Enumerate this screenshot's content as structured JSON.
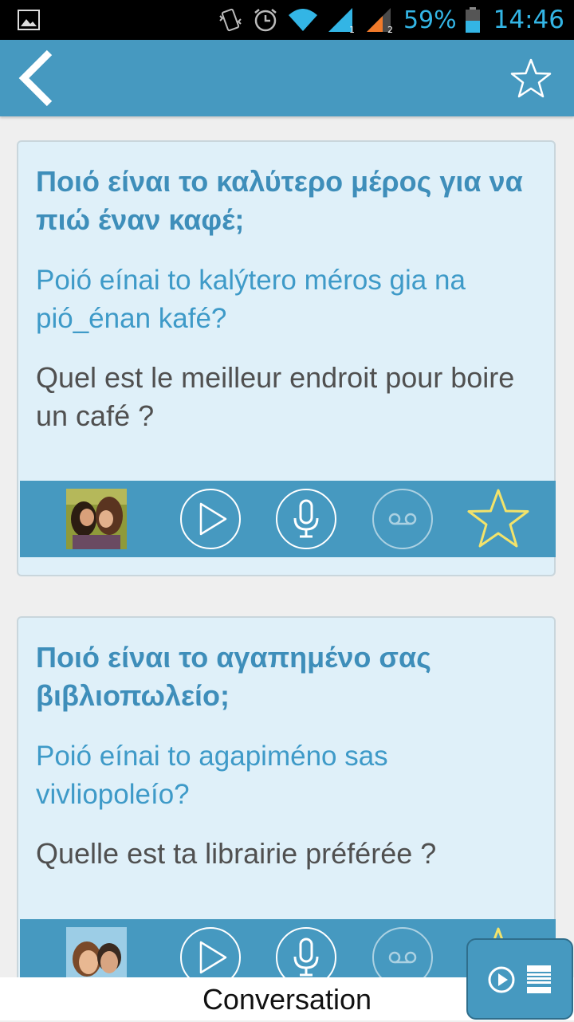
{
  "status_bar": {
    "battery": "59%",
    "time": "14:46",
    "icons": [
      "image-icon",
      "vibrate-icon",
      "alarm-icon",
      "wifi-icon",
      "signal-1-icon",
      "signal-2-icon",
      "battery-icon"
    ]
  },
  "app_bar": {
    "icons": [
      "back-icon",
      "star-outline-icon"
    ]
  },
  "phrases": [
    {
      "greek": "Ποιό είναι το καλύτερο μέρος για να πιώ έναν καφέ;",
      "transliteration": "Poió eínai to kalýtero méros gia na pió_énan kafé?",
      "french": "Quel est le meilleur endroit pour boire un café ?"
    },
    {
      "greek": "Ποιό είναι το αγαπημένο σας βιβλιοπωλείο;",
      "transliteration": "Poió eínai to agapiméno sas vivliopoleío?",
      "french": "Quelle est ta librairie préférée ?"
    }
  ],
  "toolbar_icons": [
    "photo-thumbnail",
    "play-icon",
    "microphone-icon",
    "voicemail-icon",
    "star-icon"
  ],
  "colors": {
    "accent": "#4699c0",
    "card_bg": "#dff0f9",
    "greek_text": "#3e8eba",
    "translit_text": "#3e9ac8",
    "french_text": "#505050",
    "star_yellow": "#f3e36a"
  },
  "footer": {
    "label": "Conversation",
    "fab_icons": [
      "play-circle-icon",
      "book-list-icon"
    ]
  }
}
